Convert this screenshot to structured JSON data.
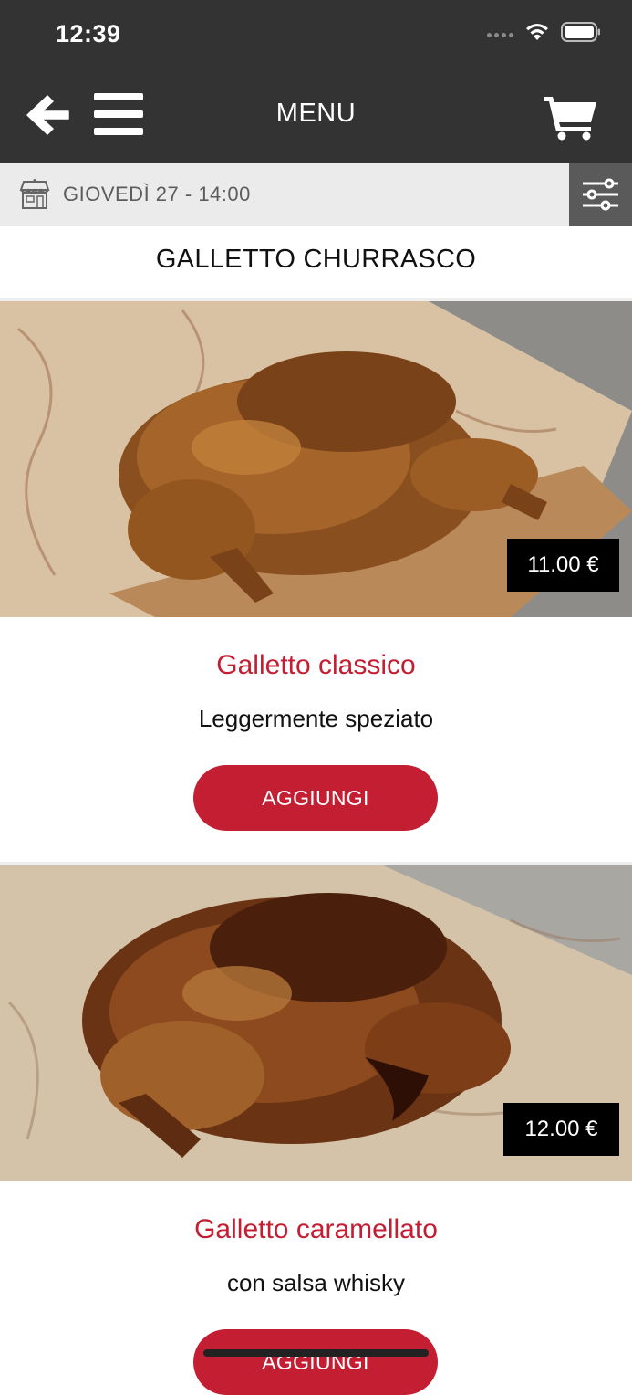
{
  "status_bar": {
    "time": "12:39"
  },
  "header": {
    "title": "MENU",
    "back_icon": "arrow-left-icon",
    "menu_icon": "hamburger-icon",
    "cart_icon": "cart-icon"
  },
  "info_bar": {
    "date_text": "GIOVEDÌ 27 - 14:00",
    "shop_icon": "store-icon",
    "filter_icon": "sliders-icon"
  },
  "category": {
    "title": "GALLETTO CHURRASCO"
  },
  "products": [
    {
      "name": "Galletto classico",
      "description": "Leggermente speziato",
      "price": "11.00 €",
      "button": "AGGIUNGI"
    },
    {
      "name": "Galletto caramellato",
      "description": "con salsa whisky",
      "price": "12.00 €",
      "button": "AGGIUNGI"
    }
  ],
  "colors": {
    "header_bg": "#333333",
    "accent": "#c41e33",
    "info_bar_bg": "#ebebeb",
    "filter_bg": "#5a5a5a"
  }
}
